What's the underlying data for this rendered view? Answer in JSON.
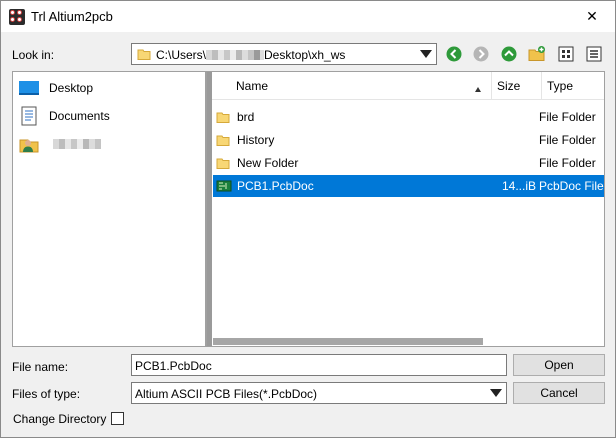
{
  "window": {
    "title": "Trl Altium2pcb",
    "close_glyph": "✕"
  },
  "look_in": {
    "label": "Look in:",
    "path_prefix": "C:\\Users\\",
    "path_suffix": "Desktop\\xh_ws"
  },
  "toolbar": {
    "back_icon": "back-arrow-icon",
    "forward_icon": "forward-arrow-icon",
    "up_icon": "up-folder-icon",
    "new_folder_icon": "new-folder-icon",
    "list_view_icon": "list-view-icon",
    "details_view_icon": "details-view-icon",
    "accent_green": "#2e9a3a"
  },
  "places": [
    {
      "label": "Desktop",
      "icon": "desktop-icon"
    },
    {
      "label": "Documents",
      "icon": "documents-icon"
    },
    {
      "label": "",
      "icon": "user-icon"
    }
  ],
  "columns": {
    "name": "Name",
    "size": "Size",
    "type": "Type"
  },
  "files": [
    {
      "name": "brd",
      "size": "",
      "type": "File Folder",
      "icon": "folder-icon"
    },
    {
      "name": "History",
      "size": "",
      "type": "File Folder",
      "icon": "folder-icon"
    },
    {
      "name": "New Folder",
      "size": "",
      "type": "File Folder",
      "icon": "folder-icon"
    },
    {
      "name": "PCB1.PcbDoc",
      "size": "14...iB",
      "type": "PcbDoc File",
      "icon": "pcb-file-icon",
      "selected": true
    }
  ],
  "form": {
    "file_name_label": "File name:",
    "file_name_value": "PCB1.PcbDoc",
    "files_of_type_label": "Files of type:",
    "files_of_type_value": "Altium ASCII PCB Files(*.PcbDoc)",
    "change_directory_label": "Change Directory",
    "change_directory_checked": false,
    "open_label": "Open",
    "cancel_label": "Cancel"
  },
  "colors": {
    "selection": "#0078d7",
    "folder": "#f8d775"
  }
}
